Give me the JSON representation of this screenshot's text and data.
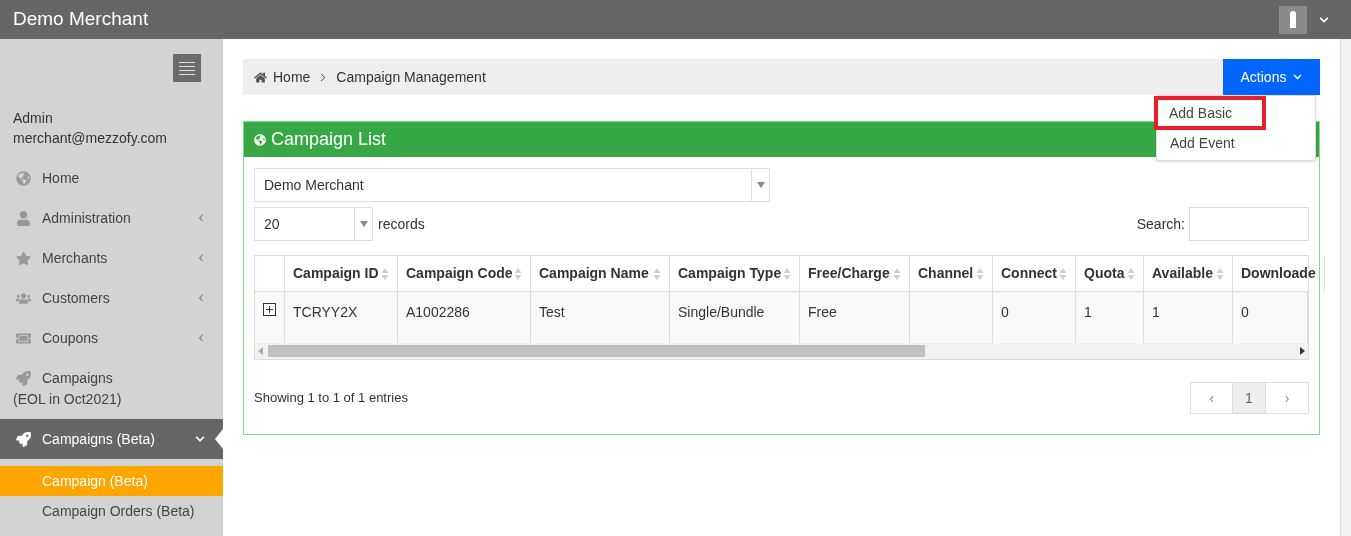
{
  "topbar": {
    "title": "Demo Merchant"
  },
  "sidebar": {
    "user": {
      "role": "Admin",
      "email": "merchant@mezzofy.com"
    },
    "items": [
      {
        "label": "Home",
        "has_submenu": false,
        "selected": false
      },
      {
        "label": "Administration",
        "has_submenu": true,
        "expanded": false,
        "selected": false
      },
      {
        "label": "Merchants",
        "has_submenu": true,
        "expanded": false,
        "selected": false
      },
      {
        "label": "Customers",
        "has_submenu": true,
        "expanded": false,
        "selected": false
      },
      {
        "label": "Coupons",
        "has_submenu": true,
        "expanded": false,
        "selected": false
      },
      {
        "label": "Campaigns",
        "sublabel": "(EOL in Oct2021)",
        "has_submenu": false,
        "selected": false
      },
      {
        "label": "Campaigns (Beta)",
        "has_submenu": true,
        "expanded": true,
        "selected": true,
        "children": [
          {
            "label": "Campaign (Beta)",
            "selected": true
          },
          {
            "label": "Campaign Orders (Beta)",
            "selected": false
          }
        ]
      }
    ]
  },
  "breadcrumb": [
    "Home",
    "Campaign Management"
  ],
  "actions": {
    "label": "Actions",
    "expanded": true,
    "menu": [
      {
        "label": "Add Basic",
        "highlighted": true
      },
      {
        "label": "Add Event",
        "highlighted": false
      }
    ]
  },
  "panel": {
    "title": "Campaign List",
    "merchant_select": {
      "value": "Demo Merchant"
    },
    "page_size": {
      "value": "20",
      "suffix": "records"
    },
    "search": {
      "label": "Search:"
    },
    "table": {
      "columns": [
        "Campaign ID",
        "Campaign Code",
        "Campaign Name",
        "Campaign Type",
        "Free/Charge",
        "Channel",
        "Connect",
        "Quota",
        "Available",
        "Downloade"
      ],
      "rows": [
        {
          "expanded": false,
          "cells": [
            "TCRYY2X",
            "A1002286",
            "Test",
            "Single/Bundle",
            "Free",
            "",
            "0",
            "1",
            "1",
            "0"
          ]
        }
      ]
    },
    "info": "Showing 1 to 1 of 1 entries",
    "pagination": {
      "prev": "‹",
      "pages": [
        {
          "label": "1",
          "selected": true
        }
      ],
      "next": "›"
    }
  }
}
